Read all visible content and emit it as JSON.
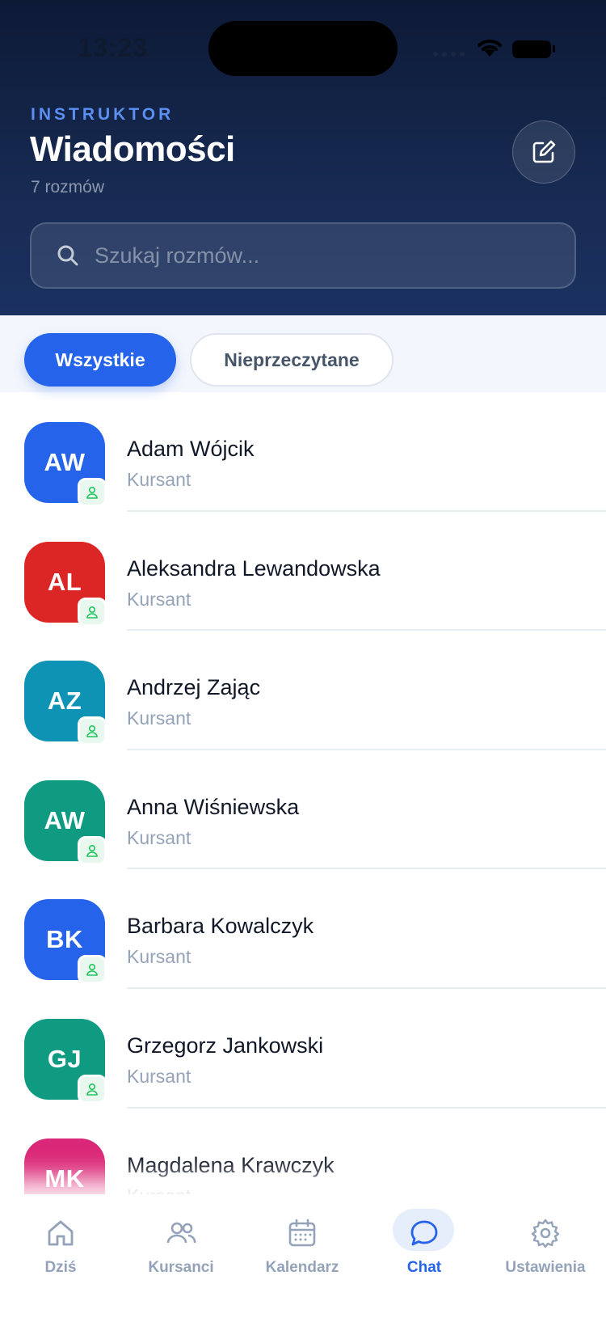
{
  "status_bar": {
    "time": "13:23"
  },
  "header": {
    "eyebrow": "INSTRUKTOR",
    "title": "Wiadomości",
    "subtitle": "7 rozmów"
  },
  "search": {
    "placeholder": "Szukaj rozmów..."
  },
  "filters": {
    "all": "Wszystkie",
    "unread": "Nieprzeczytane"
  },
  "conversations": [
    {
      "initials": "AW",
      "name": "Adam Wójcik",
      "role": "Kursant",
      "color": "#2563eb"
    },
    {
      "initials": "AL",
      "name": "Aleksandra Lewandowska",
      "role": "Kursant",
      "color": "#dc2626"
    },
    {
      "initials": "AZ",
      "name": "Andrzej Zając",
      "role": "Kursant",
      "color": "#0e93b4"
    },
    {
      "initials": "AW",
      "name": "Anna Wiśniewska",
      "role": "Kursant",
      "color": "#0f9a82"
    },
    {
      "initials": "BK",
      "name": "Barbara Kowalczyk",
      "role": "Kursant",
      "color": "#2563eb"
    },
    {
      "initials": "GJ",
      "name": "Grzegorz Jankowski",
      "role": "Kursant",
      "color": "#0f9a82"
    },
    {
      "initials": "MK",
      "name": "Magdalena Krawczyk",
      "role": "Kursant",
      "color": "#db2777"
    }
  ],
  "tabbar": {
    "home": "Dziś",
    "students": "Kursanci",
    "calendar": "Kalendarz",
    "chat": "Chat",
    "settings": "Ustawienia"
  },
  "colors": {
    "accent": "#2563eb",
    "badge_green": "#22c55e"
  }
}
